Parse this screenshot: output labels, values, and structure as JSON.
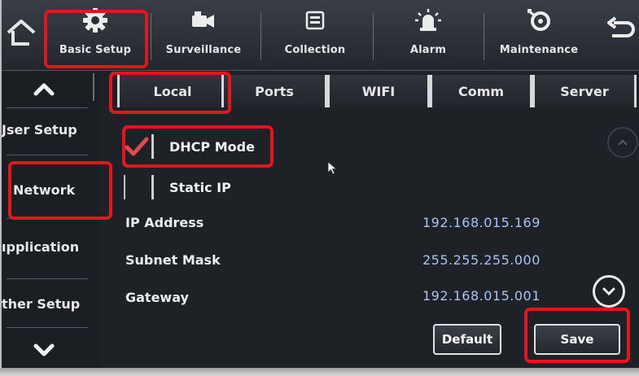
{
  "top_nav": {
    "items": [
      {
        "label": "Basic Setup",
        "icon": "gear-icon"
      },
      {
        "label": "Surveillance",
        "icon": "camera-icon"
      },
      {
        "label": "Collection",
        "icon": "storage-icon"
      },
      {
        "label": "Alarm",
        "icon": "alarm-light-icon"
      },
      {
        "label": "Maintenance",
        "icon": "maintenance-gear-icon"
      }
    ],
    "home_icon": "home-icon",
    "back_icon": "back-arrow-icon"
  },
  "sidebar": {
    "items": [
      {
        "label": "Jser Setup"
      },
      {
        "label": "Network"
      },
      {
        "label": "ıpplication"
      },
      {
        "label": "ther Setup"
      }
    ],
    "up_icon": "chevron-up-icon",
    "down_icon": "chevron-down-icon"
  },
  "tabs": [
    {
      "label": "Local"
    },
    {
      "label": "Ports"
    },
    {
      "label": "WIFI"
    },
    {
      "label": "Comm"
    },
    {
      "label": "Server"
    }
  ],
  "network": {
    "dhcp_label": "DHCP Mode",
    "dhcp_checked": true,
    "static_label": "Static IP",
    "static_checked": false,
    "fields": [
      {
        "label": "IP Address",
        "value": "192.168.015.169"
      },
      {
        "label": "Subnet Mask",
        "value": "255.255.255.000"
      },
      {
        "label": "Gateway",
        "value": "192.168.015.001"
      }
    ]
  },
  "buttons": {
    "default_label": "Default",
    "save_label": "Save"
  },
  "colors": {
    "highlight": "#e3151e",
    "checkmark": "#e0494f",
    "value_text": "#a9c3f2",
    "background": "#1e2126"
  }
}
